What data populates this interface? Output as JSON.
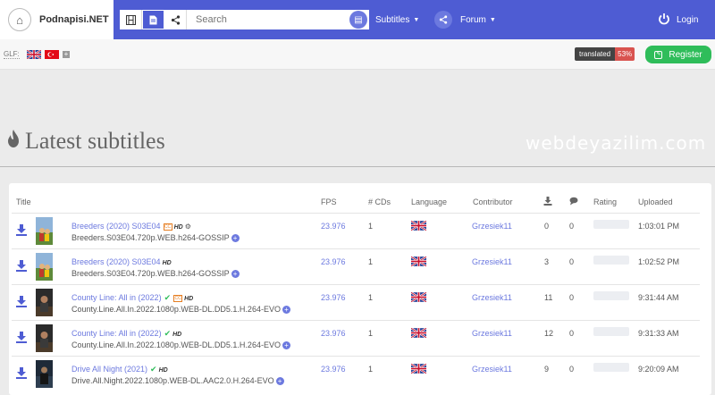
{
  "brand": {
    "name": "Podnapisi.NET"
  },
  "search": {
    "placeholder": "Search"
  },
  "nav": {
    "subtitles": "Subtitles",
    "forum": "Forum",
    "login": "Login"
  },
  "subbar": {
    "glf": "GLF:",
    "plus": "+",
    "translated_label": "translated",
    "translated_value": "53%",
    "register": "Register"
  },
  "page": {
    "title": "Latest subtitles",
    "watermark": "webdeyazilim.com"
  },
  "table": {
    "headers": {
      "title": "Title",
      "fps": "FPS",
      "cds": "# CDs",
      "language": "Language",
      "contributor": "Contributor",
      "rating": "Rating",
      "uploaded": "Uploaded"
    },
    "rows": [
      {
        "title": "Breeders (2020) S03E04",
        "release": "Breeders.S03E04.720p.WEB.h264-GOSSIP",
        "fps": "23.976",
        "cds": "1",
        "contributor": "Grzesiek11",
        "downloads": "0",
        "comments": "0",
        "uploaded": "1:03:01 PM",
        "hd": "HD"
      },
      {
        "title": "Breeders (2020) S03E04",
        "release": "Breeders.S03E04.720p.WEB.h264-GOSSIP",
        "fps": "23.976",
        "cds": "1",
        "contributor": "Grzesiek11",
        "downloads": "3",
        "comments": "0",
        "uploaded": "1:02:52 PM",
        "hd": "HD"
      },
      {
        "title": "County Line: All in (2022)",
        "release": "County.Line.All.In.2022.1080p.WEB-DL.DD5.1.H.264-EVO",
        "fps": "23.976",
        "cds": "1",
        "contributor": "Grzesiek11",
        "downloads": "11",
        "comments": "0",
        "uploaded": "9:31:44 AM",
        "hd": "HD"
      },
      {
        "title": "County Line: All in (2022)",
        "release": "County.Line.All.In.2022.1080p.WEB-DL.DD5.1.H.264-EVO",
        "fps": "23.976",
        "cds": "1",
        "contributor": "Grzesiek11",
        "downloads": "12",
        "comments": "0",
        "uploaded": "9:31:33 AM",
        "hd": "HD"
      },
      {
        "title": "Drive All Night (2021)",
        "release": "Drive.All.Night.2022.1080p.WEB-DL.AAC2.0.H.264-EVO",
        "fps": "23.976",
        "cds": "1",
        "contributor": "Grzesiek11",
        "downloads": "9",
        "comments": "0",
        "uploaded": "9:20:09 AM",
        "hd": "HD"
      }
    ]
  },
  "colors": {
    "accent": "#4e5cd3",
    "link": "#6c79df",
    "register": "#2fbd5a",
    "badge_red": "#d9534f",
    "background": "#ebebeb"
  },
  "icons": {
    "home": "home-icon",
    "film": "film-icon",
    "document": "document-icon",
    "share": "share-icon",
    "search": "search-icon",
    "power": "power-icon",
    "download": "download-icon",
    "comment": "comment-icon",
    "fire": "fire-icon"
  }
}
